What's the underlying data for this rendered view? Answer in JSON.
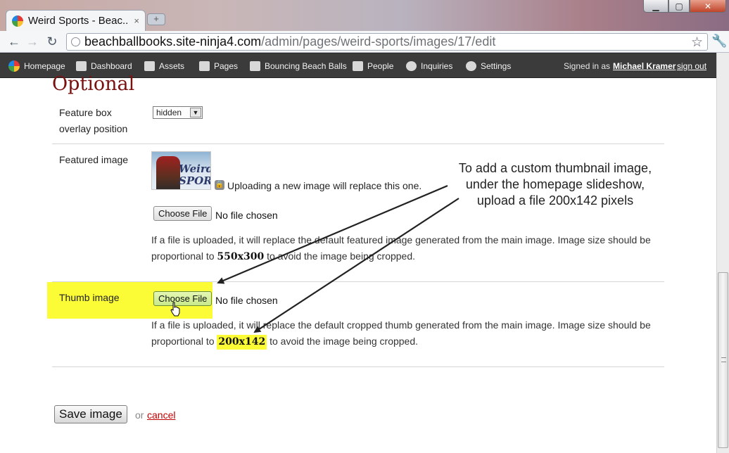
{
  "browser": {
    "tab_title": "Weird Sports - Beac...",
    "tab_close": "×",
    "new_tab": "+",
    "url_host": "beachballbooks.site-ninja4.com",
    "url_path": "/admin/pages/weird-sports/images/17/edit",
    "nav_back": "←",
    "nav_forward": "→",
    "nav_reload": "↻",
    "star": "☆",
    "wrench": "🔧"
  },
  "nav": {
    "items": [
      {
        "label": "Homepage",
        "icon": "beachball-icon"
      },
      {
        "label": "Dashboard",
        "icon": "house-icon"
      },
      {
        "label": "Assets",
        "icon": "folder-icon"
      },
      {
        "label": "Pages",
        "icon": "pages-icon"
      },
      {
        "label": "Bouncing Beach Balls",
        "icon": "book-icon"
      },
      {
        "label": "People",
        "icon": "person-icon"
      },
      {
        "label": "Inquiries",
        "icon": "speech-bubble-icon"
      },
      {
        "label": "Settings",
        "icon": "gear-icon"
      }
    ],
    "signed_in_prefix": "Signed in as",
    "user_name": "Michael Kramer",
    "sign_out": "sign out"
  },
  "form": {
    "section_title": "Optional",
    "overlay_label": "Feature box overlay position",
    "overlay_value": "hidden",
    "featured_label": "Featured image",
    "featured_thumb_text": "Weird SPORTS",
    "replace_note": "Uploading a new image will replace this one.",
    "choose_file": "Choose File",
    "no_file": "No file chosen",
    "featured_help_before": "If a file is uploaded, it will replace the default featured image generated from the main image. Image size should be proportional to ",
    "featured_size": "550x300",
    "featured_help_after": " to avoid the image being cropped.",
    "thumb_label": "Thumb image",
    "thumb_help_before": "If a file is uploaded, it will replace the default cropped thumb generated from the main image. Image size should be proportional to ",
    "thumb_size": "200x142",
    "thumb_help_after": " to avoid the image being cropped.",
    "save_button": "Save image",
    "or": "or",
    "cancel": "cancel"
  },
  "annotation": {
    "lines": [
      "To add a custom thumbnail image,",
      "under the homepage slideshow,",
      "upload a file 200x142 pixels"
    ],
    "highlight_color": "#fbfb36"
  }
}
